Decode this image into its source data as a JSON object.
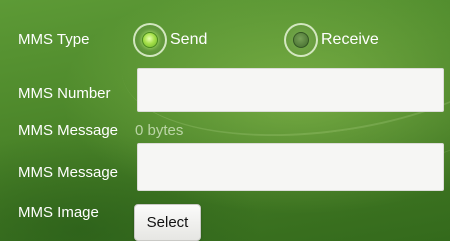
{
  "mms_type": {
    "label": "MMS Type",
    "selected": "send",
    "options": {
      "send": "Send",
      "receive": "Receive"
    }
  },
  "mms_number": {
    "label": "MMS Number",
    "value": "",
    "placeholder": ""
  },
  "mms_message_size": {
    "label": "MMS Message",
    "value": "0 bytes"
  },
  "mms_message": {
    "label": "MMS Message",
    "value": "",
    "placeholder": ""
  },
  "mms_image": {
    "label": "MMS Image",
    "button_label": "Select"
  },
  "colors": {
    "background": "#4f8a2c",
    "radio_selected": "#a6e04a",
    "field_background": "#f6f6f4"
  }
}
